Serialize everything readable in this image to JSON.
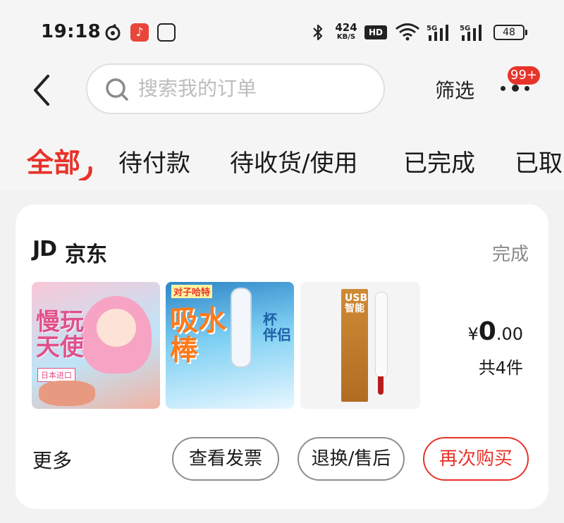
{
  "status_bar": {
    "time": "19:18",
    "net_speed_value": "424",
    "net_speed_unit": "KB/S",
    "hd_label": "HD",
    "battery": "48"
  },
  "header": {
    "search_placeholder": "搜索我的订单",
    "filter_label": "筛选",
    "badge": "99+"
  },
  "tabs": [
    {
      "label": "全部",
      "active": true
    },
    {
      "label": "待付款"
    },
    {
      "label": "待收货/使用"
    },
    {
      "label": "已完成"
    },
    {
      "label": "已取"
    }
  ],
  "order": {
    "shop_logo": "JD",
    "shop_name": "京东",
    "status": "完成",
    "thumb1": {
      "title_line1": "慢玩",
      "title_line2": "天使",
      "tag": "日本进口"
    },
    "thumb2": {
      "top": "对子哈特",
      "title_line1": "吸水",
      "title_line2": "棒",
      "side_line1": "杯",
      "side_line2": "伴侣"
    },
    "thumb3": {
      "box_text": "USB智能"
    },
    "price_symbol": "¥",
    "price_int": "0",
    "price_dec": ".00",
    "count": "共4件",
    "more_label": "更多",
    "actions": {
      "invoice": "查看发票",
      "aftersale": "退换/售后",
      "rebuy": "再次购买"
    }
  },
  "colors": {
    "accent": "#e8332a",
    "muted": "#8a8a8a"
  }
}
